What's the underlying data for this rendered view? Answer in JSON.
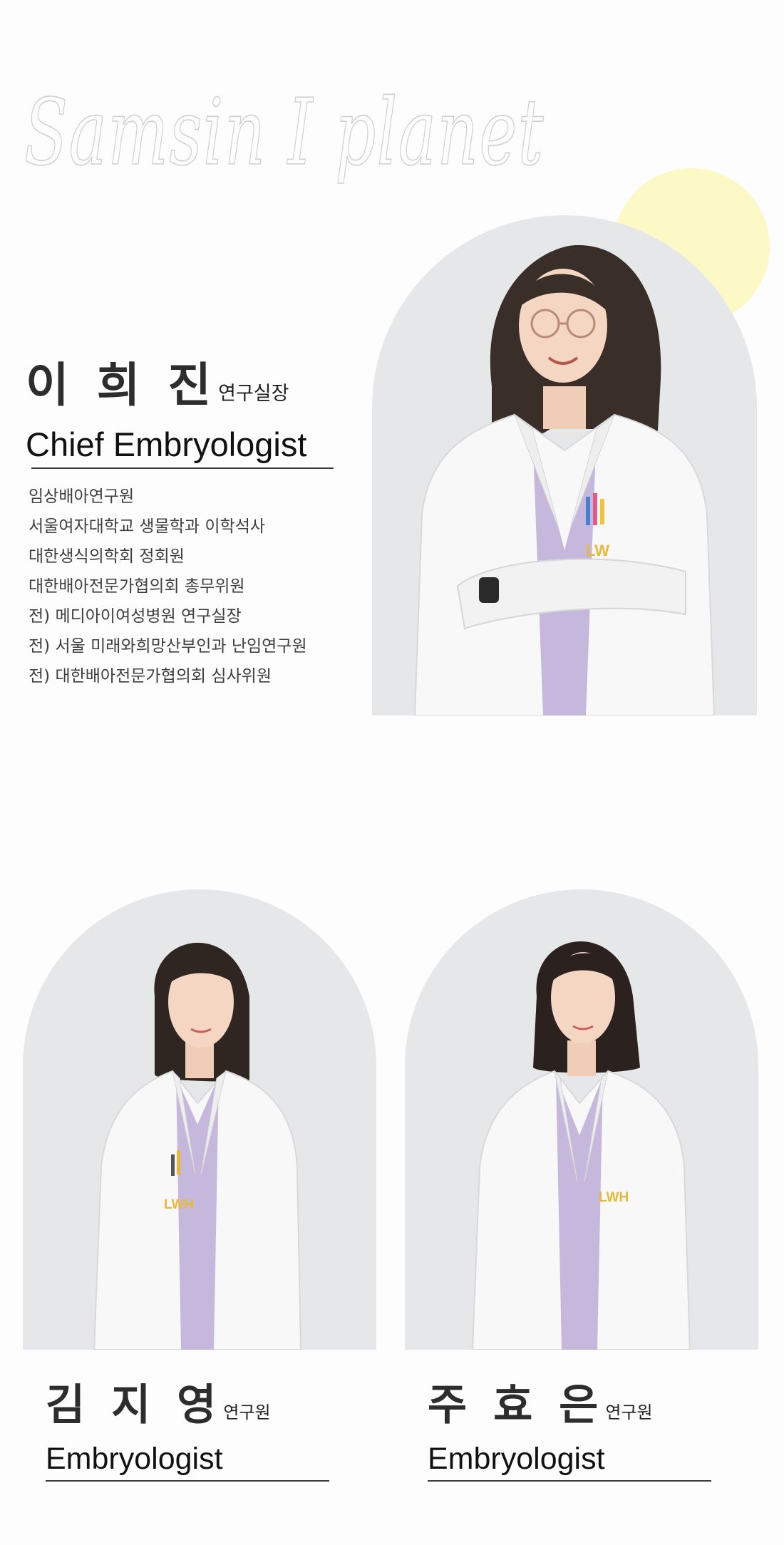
{
  "brand": {
    "script_text": "Samsin I planet"
  },
  "chief": {
    "name": "이 희 진",
    "role": "연구실장",
    "title_en": "Chief Embryologist",
    "bio": [
      "임상배아연구원",
      "서울여자대학교 생물학과 이학석사",
      "대한생식의학회 정회원",
      "대한배아전문가협의회 총무위원",
      "전) 메디아이여성병원 연구실장",
      "전) 서울 미래와희망산부인과 난임연구원",
      "전) 대한배아전문가협의회 심사위원"
    ],
    "coat_logo": "LW"
  },
  "staff": [
    {
      "name": "김 지 영",
      "role": "연구원",
      "title_en": "Embryologist",
      "coat_logo": "LWH"
    },
    {
      "name": "주 효 은",
      "role": "연구원",
      "title_en": "Embryologist",
      "coat_logo": "LWH"
    }
  ],
  "colors": {
    "background": "#fdfdfd",
    "accent_circle": "#fdf9c6",
    "arch_backdrop": "#e6e7e9",
    "scrub_lavender": "#c6b8dc",
    "logo_yellow": "#e8b83a"
  }
}
